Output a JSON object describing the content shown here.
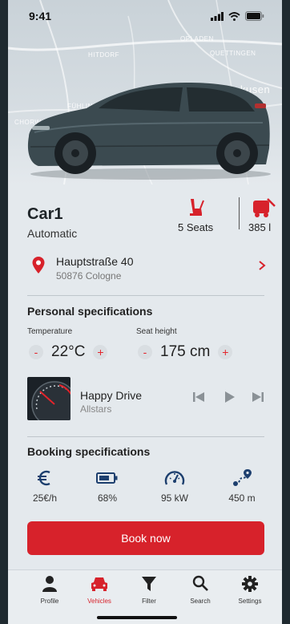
{
  "status": {
    "time": "9:41"
  },
  "map": {
    "labels": [
      "OPLADEN",
      "HITDORF",
      "QUETTINGEN",
      "CHORW",
      "FÜHLING",
      "kusen"
    ]
  },
  "car": {
    "name": "Car1",
    "transmission": "Automatic",
    "seats": "5 Seats",
    "range": "385 l"
  },
  "address": {
    "street": "Hauptstraße 40",
    "city": "50876 Cologne"
  },
  "personal": {
    "title": "Personal specifications",
    "temperature_label": "Temperature",
    "temperature_value": "22°C",
    "seat_label": "Seat height",
    "seat_value": "175 cm",
    "minus": "-",
    "plus": "+"
  },
  "media": {
    "title": "Happy Drive",
    "artist": "Allstars"
  },
  "booking": {
    "title": "Booking specifications",
    "price": "25€/h",
    "battery": "68%",
    "power": "95 kW",
    "distance": "450 m",
    "button": "Book now"
  },
  "tabs": {
    "profile": "Profile",
    "vehicles": "Vehicles",
    "filter": "Filter",
    "search": "Search",
    "settings": "Settings"
  },
  "colors": {
    "accent": "#d7222b",
    "background": "#e4e9ed",
    "text": "#1e2428"
  }
}
